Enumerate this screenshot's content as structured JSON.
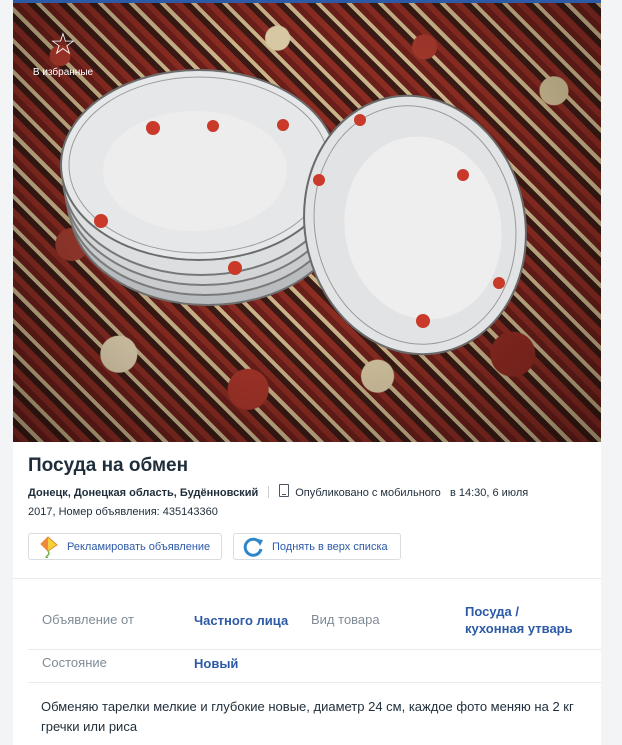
{
  "favorites": {
    "icon": "star-outline-icon",
    "label": "В избранные"
  },
  "ad": {
    "title": "Посуда на обмен",
    "location": "Донецк, Донецкая область, Будённовский",
    "published": "Опубликовано с мобильного",
    "published_time": "в 14:30, 6 июля",
    "published_year_and_id": "2017, Номер объявления: 435143360"
  },
  "actions": {
    "promote_label": "Рекламировать объявление",
    "promote_icon": "kite-icon",
    "raise_label": "Поднять в верх списка",
    "raise_icon": "refresh-icon"
  },
  "details": [
    {
      "label": "Объявление от",
      "value": "Частного лица"
    },
    {
      "label": "Вид товара",
      "value": "Посуда / кухонная утварь"
    },
    {
      "label": "Состояние",
      "value": "Новый"
    }
  ],
  "description": "Обменяю тарелки мелкие и глубокие новые, диаметр 24 см, каждое фото меняю на 2 кг гречки или риса",
  "colors": {
    "accent": "#2c5aa7",
    "text": "#1f2d3a",
    "muted": "#7f8b96"
  }
}
